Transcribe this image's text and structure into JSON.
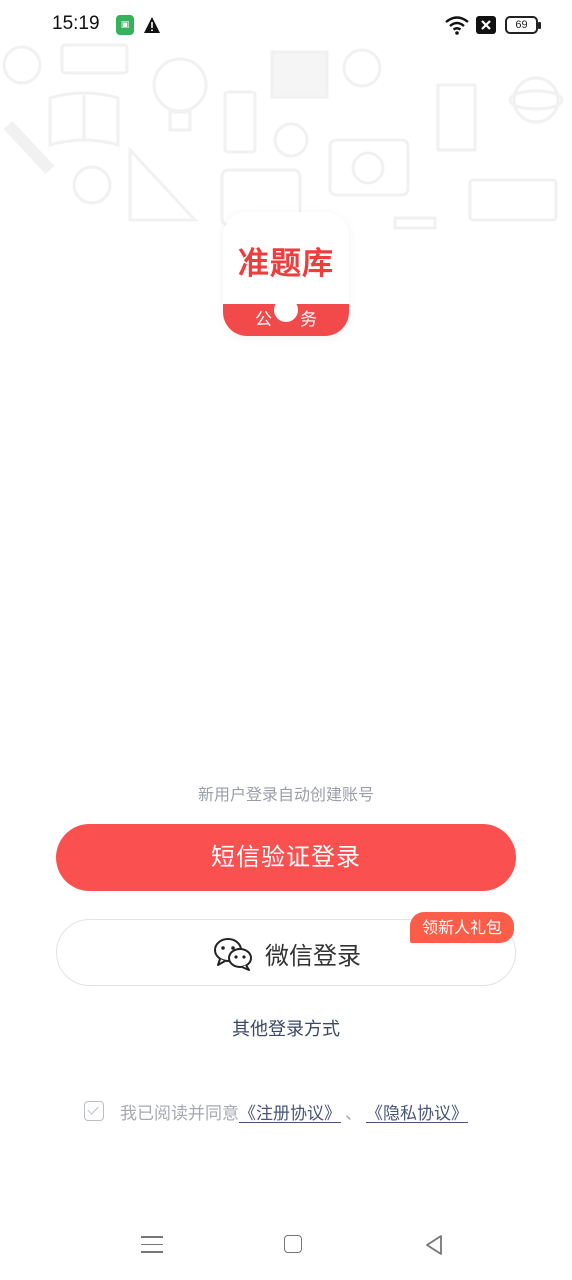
{
  "status_bar": {
    "time": "15:19",
    "battery_level": "69",
    "icons": [
      "app-notification-icon",
      "warning-icon",
      "wifi-icon",
      "signal-off-icon",
      "battery-icon"
    ]
  },
  "logo": {
    "name": "准题库",
    "subtitle": "公务"
  },
  "login": {
    "hint": "新用户登录自动创建账号",
    "sms_button": "短信验证登录",
    "wechat_button": "微信登录",
    "gift_badge": "领新人礼包",
    "other_login": "其他登录方式"
  },
  "agreement": {
    "prefix": "我已阅读并同意",
    "register_link": "《注册协议》",
    "separator": "、",
    "privacy_link": "《隐私协议》",
    "checked": false
  },
  "nav_bar": {
    "buttons": [
      "menu",
      "home",
      "back"
    ]
  },
  "colors": {
    "primary": "#fb5050",
    "badge": "#fb5d48",
    "link": "#4a5578",
    "hint": "#9a9ea8"
  }
}
